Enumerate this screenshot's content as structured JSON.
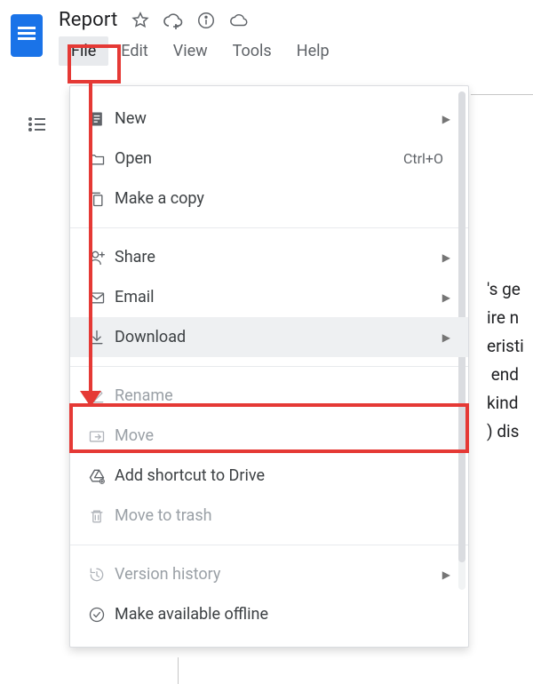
{
  "header": {
    "doc_title": "Report",
    "menus": [
      "File",
      "Edit",
      "View",
      "Tools",
      "Help"
    ],
    "active_index": 0
  },
  "menu": {
    "items": [
      {
        "icon": "page-plus-icon",
        "label": "New",
        "submenu": true
      },
      {
        "icon": "folder-icon",
        "label": "Open",
        "shortcut": "Ctrl+O"
      },
      {
        "icon": "copy-icon",
        "label": "Make a copy"
      },
      {
        "sep": true
      },
      {
        "icon": "person-plus-icon",
        "label": "Share",
        "submenu": true
      },
      {
        "icon": "mail-icon",
        "label": "Email",
        "submenu": true
      },
      {
        "icon": "download-icon",
        "label": "Download",
        "submenu": true,
        "hovered": true
      },
      {
        "sep": true
      },
      {
        "icon": "pencil-icon",
        "label": "Rename",
        "disabled": true
      },
      {
        "icon": "move-icon",
        "label": "Move",
        "disabled": true
      },
      {
        "icon": "drive-shortcut-icon",
        "label": "Add shortcut to Drive"
      },
      {
        "icon": "trash-icon",
        "label": "Move to trash",
        "disabled": true
      },
      {
        "sep": true
      },
      {
        "icon": "history-icon",
        "label": "Version history",
        "disabled": true,
        "submenu": true
      },
      {
        "icon": "offline-icon",
        "label": "Make available offline"
      }
    ]
  },
  "doc_peek": "'s ge\nire n\neristi\n end\nkind\n) dis"
}
